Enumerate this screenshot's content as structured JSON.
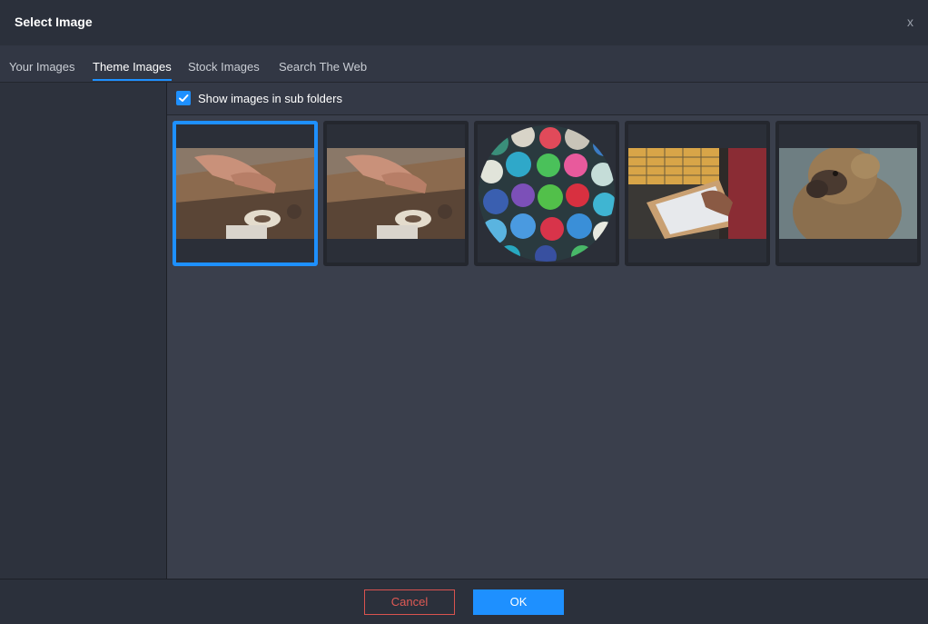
{
  "dialog": {
    "title": "Select Image",
    "close_label": "x"
  },
  "tabs": [
    {
      "label": "Your Images",
      "active": false
    },
    {
      "label": "Theme Images",
      "active": true
    },
    {
      "label": "Stock Images",
      "active": false
    },
    {
      "label": "Search The Web",
      "active": false
    }
  ],
  "toolbar": {
    "show_subfolders_label": "Show images in sub folders",
    "show_subfolders_checked": true
  },
  "thumbnails": [
    {
      "subject": "hands-taping-wood",
      "selected": true
    },
    {
      "subject": "hands-taping-wood",
      "selected": false
    },
    {
      "subject": "paint-jars-circle",
      "selected": false
    },
    {
      "subject": "screen-printing-frame",
      "selected": false
    },
    {
      "subject": "baboon-portrait",
      "selected": false
    }
  ],
  "footer": {
    "cancel_label": "Cancel",
    "ok_label": "OK"
  },
  "colors": {
    "accent": "#1e90ff",
    "cancel": "#e05a55",
    "background": "#3a3f4c"
  }
}
